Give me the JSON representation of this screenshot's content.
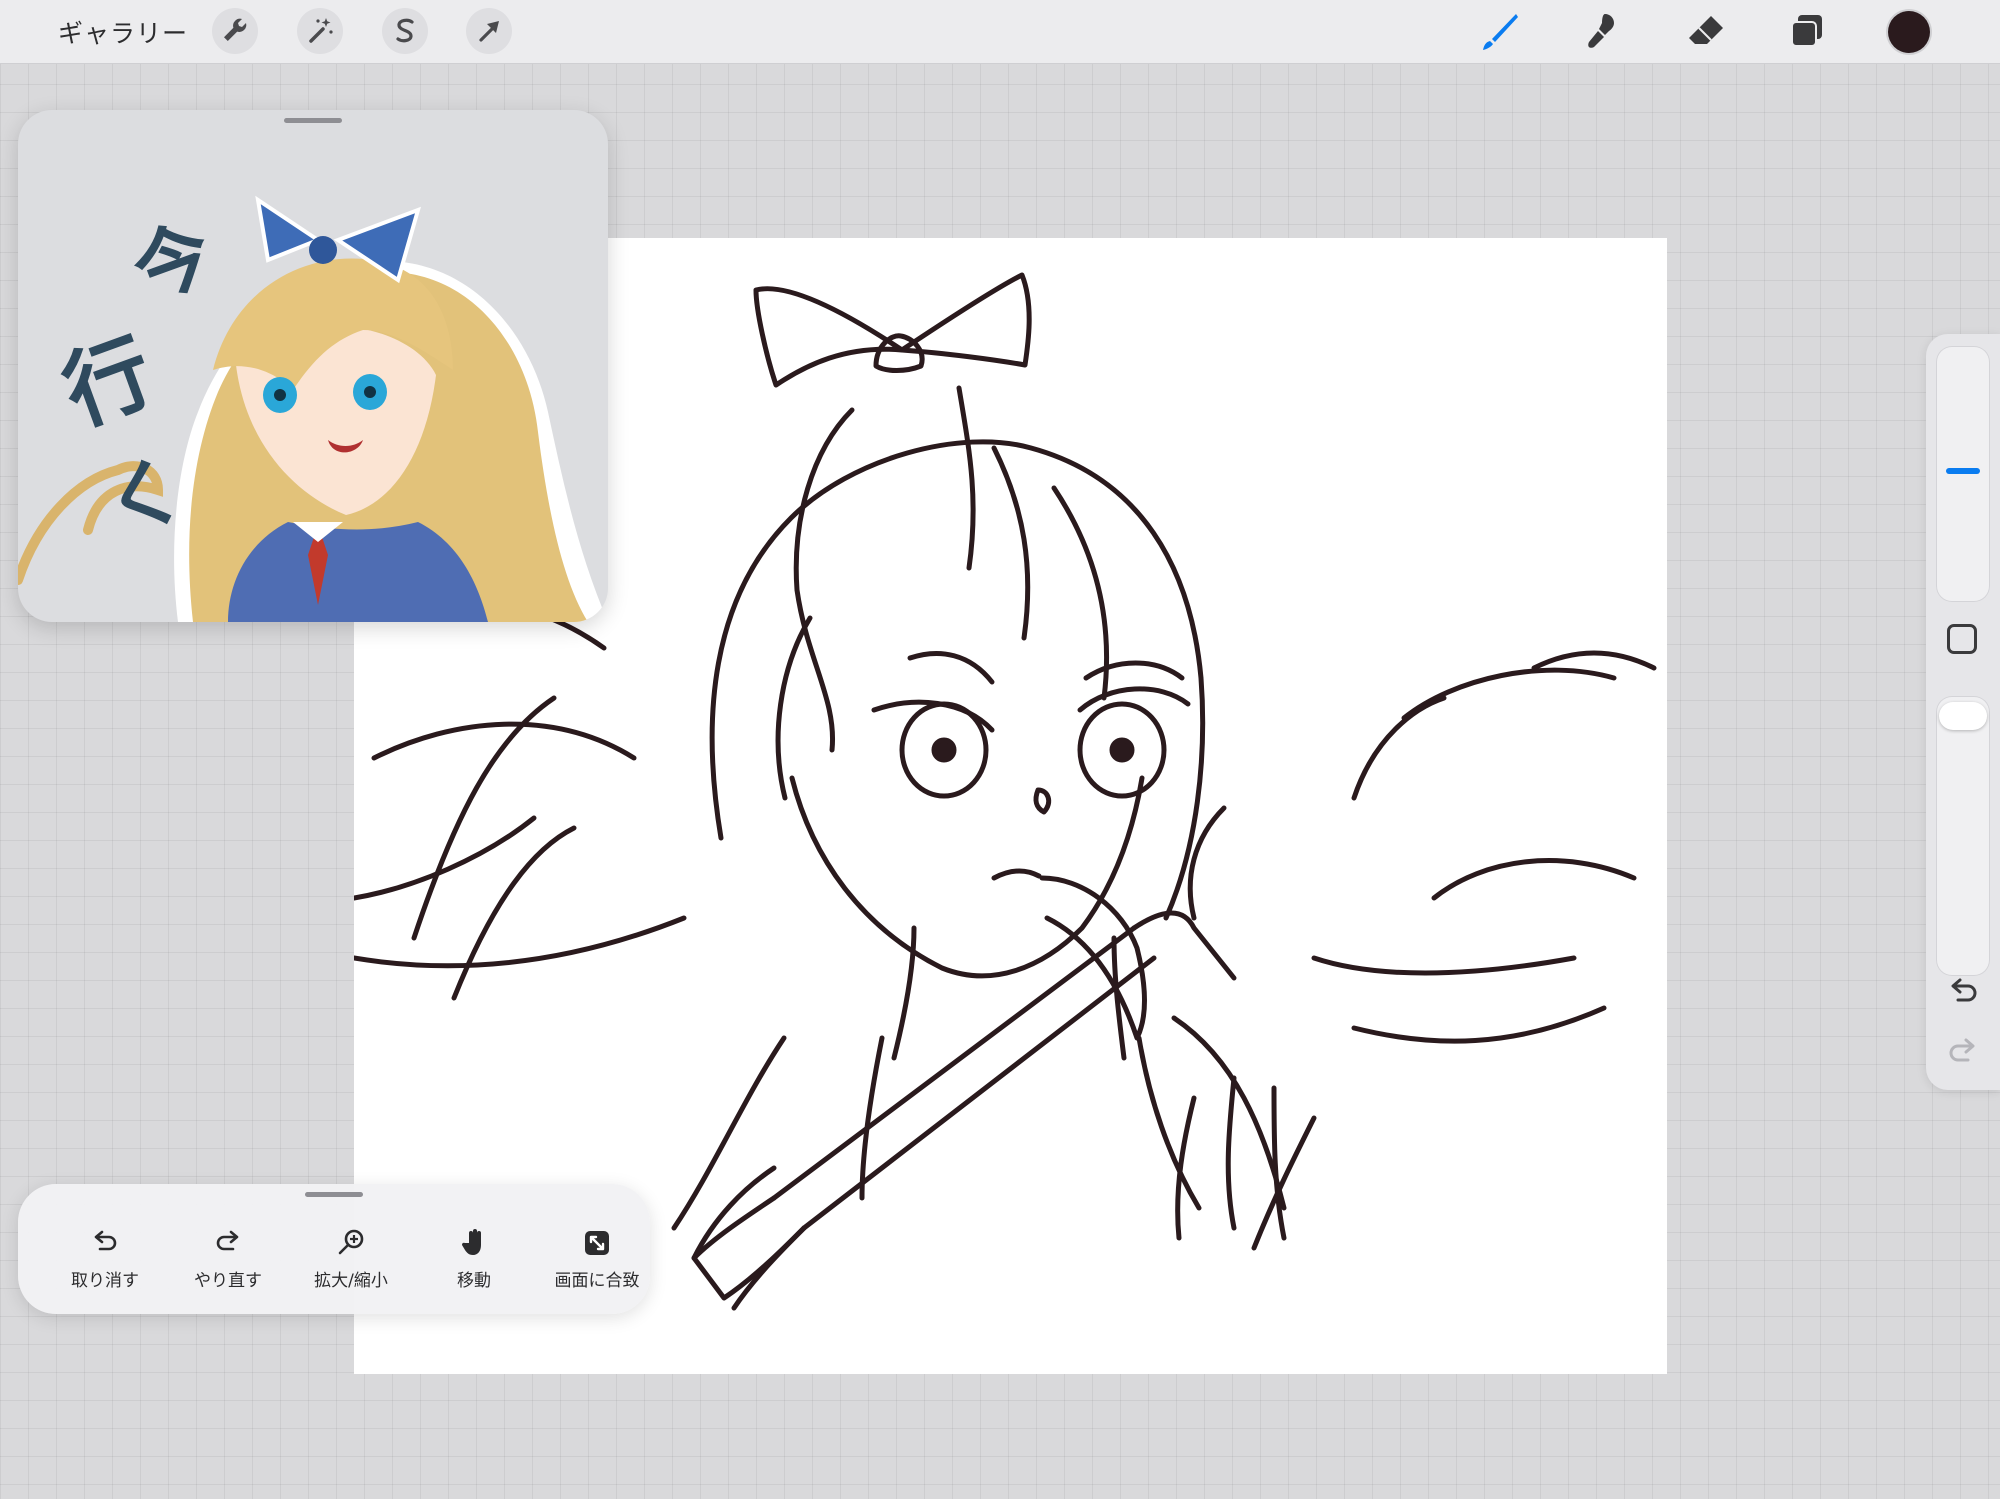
{
  "toolbar": {
    "gallery_label": "ギャラリー",
    "left_tools": [
      {
        "icon": "wrench-icon",
        "name": "actions"
      },
      {
        "icon": "magic-wand-icon",
        "name": "adjustments"
      },
      {
        "icon": "selection-s-icon",
        "name": "selection"
      },
      {
        "icon": "arrow-cursor-icon",
        "name": "transform"
      }
    ],
    "right_tools": [
      {
        "icon": "brush-icon",
        "name": "paint",
        "active": true,
        "color": "#0a7cf0"
      },
      {
        "icon": "smudge-icon",
        "name": "smudge"
      },
      {
        "icon": "eraser-icon",
        "name": "eraser"
      },
      {
        "icon": "layers-icon",
        "name": "layers"
      }
    ],
    "current_color": "#2a1a1d"
  },
  "reference_window": {
    "text_lines": [
      "今",
      "行",
      "く"
    ]
  },
  "sidebar": {
    "accent_color": "#0a7cf0",
    "modify_button_icon": "square-icon",
    "undo_icon": "undo-icon",
    "redo_icon": "redo-icon"
  },
  "quick_menu": {
    "items": [
      {
        "label": "取り消す",
        "icon": "undo-icon"
      },
      {
        "label": "やり直す",
        "icon": "redo-icon"
      },
      {
        "label": "拡大/縮小",
        "icon": "zoom-icon"
      },
      {
        "label": "移動",
        "icon": "hand-icon"
      },
      {
        "label": "画面に合致",
        "icon": "fit-screen-icon"
      }
    ]
  }
}
